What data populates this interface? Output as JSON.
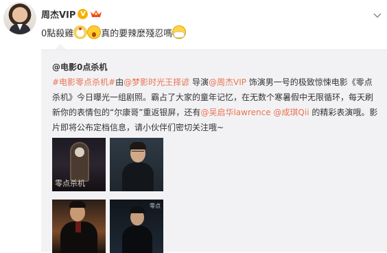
{
  "post": {
    "username": "周杰VIP",
    "badge_icon": "verified-badge-icon",
    "crown_icon": "vip-crown-icon",
    "text_part1": "0點殺雞",
    "text_part2": "真的要辣麼殘忍嗎",
    "emojis": [
      "chick-emoji-icon",
      "shocked-emoji-icon",
      "mask-emoji-icon"
    ]
  },
  "repost": {
    "author": "@电影0点杀机",
    "topic1": "#电影零点杀机#",
    "text_a": "由",
    "link_director": "@梦影时光王择谚",
    "text_b": " 导演",
    "link_actor": "@周杰VIP",
    "text_c": " 饰演男一号的极致惊悚电影《零点杀机》今日曝光一组剧照。霸占了大家的童年记忆，在无数个寒暑假中无限循环，每天刷新你的表情包的“尔康哥”重返银屏，还有",
    "link_actor2": "@吴启华lawrence",
    "text_d": " ",
    "link_actor3": "@成琪Qii",
    "text_e": " 的精彩表演哦。影片即将公布定档信息，请小伙伴们密切关注哦~",
    "thumbnails": [
      {
        "title": "零点杀机"
      },
      {
        "title": ""
      },
      {
        "title": ""
      },
      {
        "title": "零点"
      }
    ]
  },
  "colors": {
    "link": "#eb7350",
    "repost_bg": "#f2f2f5",
    "badge": "#f6b100"
  }
}
